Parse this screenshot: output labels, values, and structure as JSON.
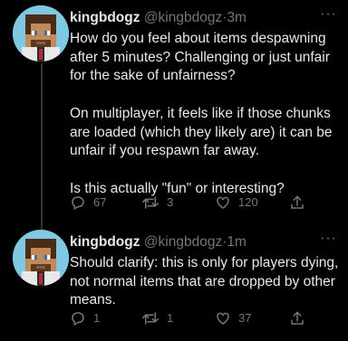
{
  "tweets": [
    {
      "display_name": "kingbdogz",
      "handle": "@kingbdogz",
      "separator": "·",
      "time": "3m",
      "paragraphs": [
        "How do you feel about items despawning after 5 minutes? Challenging or just unfair for the sake of unfairness?",
        "On multiplayer, it feels like if those chunks are loaded (which they likely are) it can be unfair if you respawn far away.",
        "Is this actually \"fun\" or interesting?"
      ],
      "reply_count": "67",
      "retweet_count": "3",
      "like_count": "120",
      "more_label": "···"
    },
    {
      "display_name": "kingbdogz",
      "handle": "@kingbdogz",
      "separator": "·",
      "time": "1m",
      "paragraphs": [
        "Should clarify: this is only for players dying, not normal items that are dropped by other means."
      ],
      "reply_count": "1",
      "retweet_count": "1",
      "like_count": "37",
      "more_label": "···"
    }
  ],
  "icons": {
    "reply": "reply-icon",
    "retweet": "retweet-icon",
    "like": "heart-icon",
    "share": "share-icon",
    "more": "more-icon"
  },
  "colors": {
    "background": "#000000",
    "text": "#e7e9ea",
    "secondary": "#71767b",
    "thread_line": "#2f3336"
  }
}
